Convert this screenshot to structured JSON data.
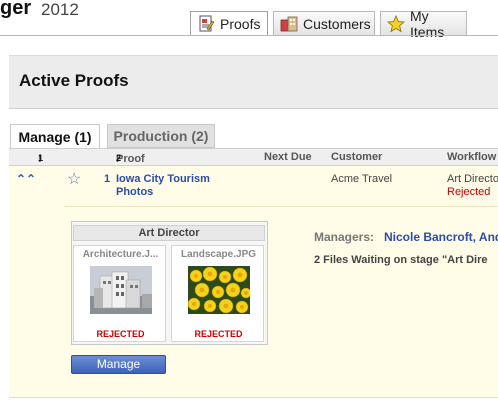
{
  "header": {
    "app_title_fragment": "ger",
    "year": "2012"
  },
  "top_tabs": [
    {
      "label": "Proofs",
      "icon": "proofs-document-icon",
      "active": true
    },
    {
      "label": "Customers",
      "icon": "customers-icon",
      "active": false
    },
    {
      "label": "My Items",
      "icon": "star-icon",
      "active": false
    }
  ],
  "banner": {
    "title": "Active Proofs"
  },
  "sub_tabs": [
    {
      "label": "Manage (1)",
      "active": true
    },
    {
      "label": "Production (2)",
      "active": false
    }
  ],
  "columns": {
    "priority": "!",
    "priority_sort": "1",
    "proof": "Proof",
    "proof_sort": "2",
    "next_due": "Next Due",
    "customer": "Customer",
    "workflow": "Workflow"
  },
  "row": {
    "number": "1",
    "proof_name": "Iowa City Tourism Photos",
    "next_due": "",
    "customer": "Acme Travel",
    "workflow": "Art Director",
    "workflow_status": "Rejected"
  },
  "stage": {
    "title": "Art Director",
    "files": [
      {
        "name": "Architecture.J...",
        "status": "REJECTED"
      },
      {
        "name": "Landscape.JPG",
        "status": "REJECTED"
      }
    ]
  },
  "actions": {
    "manage_label": "Manage"
  },
  "managers": {
    "label": "Managers:",
    "names": "Nicole Bancroft, And"
  },
  "files_waiting": "2 Files Waiting on stage \"Art Dire",
  "colors": {
    "link": "#2c4da8",
    "rejected": "#cc0000",
    "row_bg": "#fffde8"
  }
}
